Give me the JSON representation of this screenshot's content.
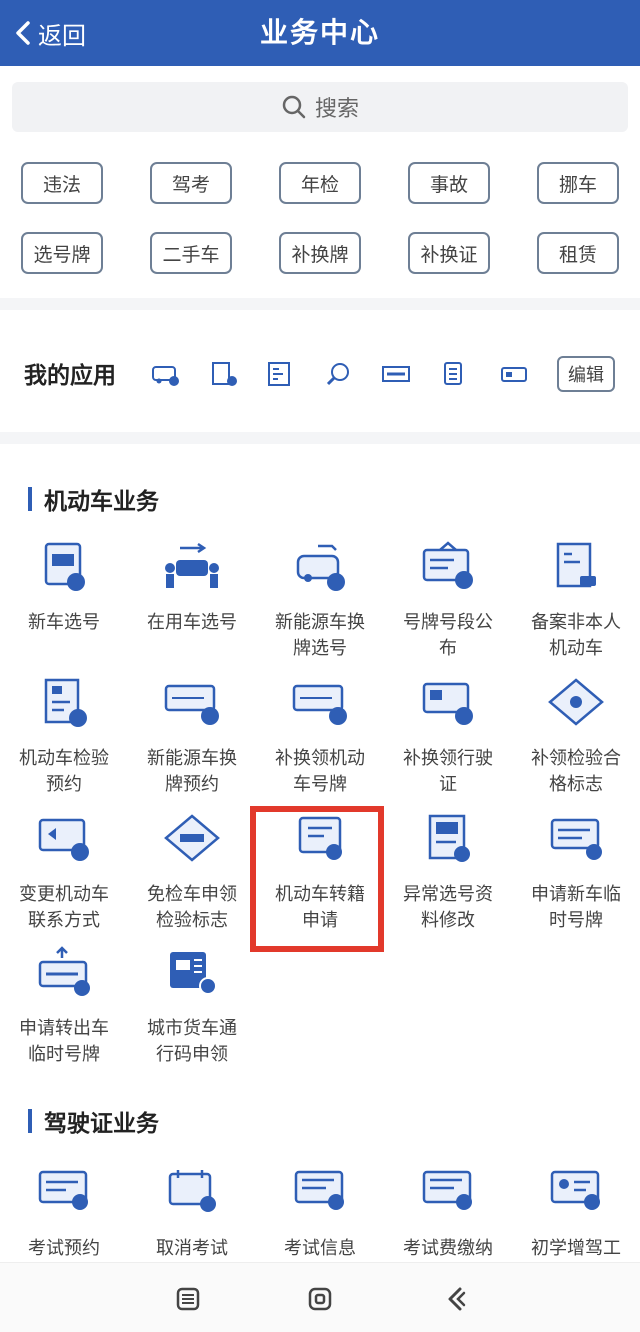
{
  "header": {
    "back_label": "返回",
    "title": "业务中心",
    "color": "#2f5eb5"
  },
  "search": {
    "placeholder": "搜索"
  },
  "tags": [
    "违法",
    "驾考",
    "年检",
    "事故",
    "挪车",
    "选号牌",
    "二手车",
    "补换牌",
    "补换证",
    "租赁"
  ],
  "my_apps": {
    "label": "我的应用",
    "icons": [
      "car-icon",
      "document-icon",
      "form-icon",
      "search-car-icon",
      "license-plate-icon",
      "list-icon",
      "card-icon"
    ],
    "edit_label": "编辑"
  },
  "vehicle_section": {
    "title": "机动车业务",
    "items": [
      {
        "label": "新车选号",
        "icon": "new-car-icon"
      },
      {
        "label": "在用车选号",
        "icon": "car-exchange-icon"
      },
      {
        "label": "新能源车换牌选号",
        "icon": "ev-car-icon"
      },
      {
        "label": "号牌号段公布",
        "icon": "board-icon"
      },
      {
        "label": "备案非本人机动车",
        "icon": "registration-icon"
      },
      {
        "label": "机动车检验预约",
        "icon": "inspection-icon"
      },
      {
        "label": "新能源车换牌预约",
        "icon": "plate-reserve-icon"
      },
      {
        "label": "补换领机动车号牌",
        "icon": "plate-replace-icon"
      },
      {
        "label": "补换领行驶证",
        "icon": "license-replace-icon"
      },
      {
        "label": "补领检验合格标志",
        "icon": "diamond-badge-icon"
      },
      {
        "label": "变更机动车联系方式",
        "icon": "contact-change-icon"
      },
      {
        "label": "免检车申领检验标志",
        "icon": "exempt-badge-icon"
      },
      {
        "label": "机动车转籍申请",
        "icon": "transfer-icon"
      },
      {
        "label": "异常选号资料修改",
        "icon": "edit-doc-icon"
      },
      {
        "label": "申请新车临时号牌",
        "icon": "temp-plate-icon"
      },
      {
        "label": "申请转出车临时号牌",
        "icon": "temp-plate-out-icon"
      },
      {
        "label": "城市货车通行码申领",
        "icon": "truck-pass-icon"
      }
    ]
  },
  "license_section": {
    "title": "驾驶证业务",
    "items": [
      {
        "label": "考试预约",
        "icon": "exam-reserve-icon"
      },
      {
        "label": "取消考试",
        "icon": "calendar-cancel-icon"
      },
      {
        "label": "考试信息",
        "icon": "exam-info-icon"
      },
      {
        "label": "考试费缴纳",
        "icon": "payment-icon"
      },
      {
        "label": "初学增驾工",
        "icon": "id-card-icon"
      }
    ]
  },
  "bottom_nav": [
    "menu-icon",
    "home-icon",
    "back-icon"
  ],
  "highlight_color": "#e2392b"
}
